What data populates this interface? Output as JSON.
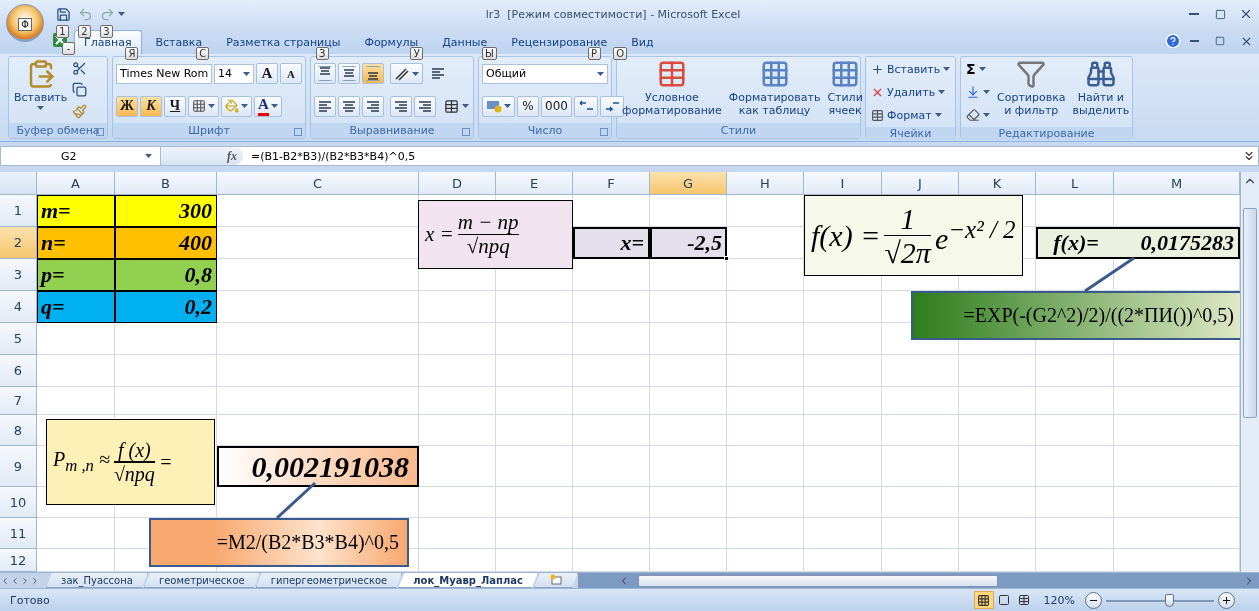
{
  "window": {
    "title": "lr3  [Режим совместимости] - Microsoft Excel",
    "office_keytip": "Ф",
    "quick_access_keytips": [
      "1",
      "2",
      "3"
    ],
    "app_icon_keytip": "-"
  },
  "tabs": [
    {
      "label": "Главная",
      "selected": true,
      "keytip": "Я"
    },
    {
      "label": "Вставка",
      "selected": false,
      "keytip": "С"
    },
    {
      "label": "Разметка страницы",
      "selected": false,
      "keytip": "З"
    },
    {
      "label": "Формулы",
      "selected": false,
      "keytip": "У"
    },
    {
      "label": "Данные",
      "selected": false,
      "keytip": "Ы"
    },
    {
      "label": "Рецензирование",
      "selected": false,
      "keytip": "Р"
    },
    {
      "label": "Вид",
      "selected": false,
      "keytip": "О"
    }
  ],
  "ribbon": {
    "clipboard": {
      "label": "Буфер обмена",
      "paste": "Вставить"
    },
    "font": {
      "label": "Шрифт",
      "font_name": "Times New Rom",
      "font_size": "14",
      "grow": "A",
      "shrink": "A",
      "styles": [
        {
          "label": "Ж",
          "on": true
        },
        {
          "label": "К",
          "on": true
        },
        {
          "label": "Ч",
          "on": false
        }
      ],
      "font_color": "A"
    },
    "alignment": {
      "label": "Выравнивание",
      "vertical": [
        {
          "kind": "top",
          "selected": false
        },
        {
          "kind": "middle",
          "selected": false
        },
        {
          "kind": "bottom",
          "selected": true
        }
      ]
    },
    "number": {
      "label": "Число",
      "format": "Общий",
      "percent": "%",
      "thousands": "000"
    },
    "styles": {
      "label": "Стили",
      "buttons": [
        "Условное\nформатирование",
        "Форматировать\nкак таблицу",
        "Стили\nячеек"
      ]
    },
    "cells": {
      "label": "Ячейки",
      "buttons": [
        "Вставить",
        "Удалить",
        "Формат"
      ]
    },
    "editing": {
      "label": "Редактирование",
      "sum": "Σ",
      "buttons": [
        "Сортировка\nи фильтр",
        "Найти и\nвыделить"
      ]
    }
  },
  "formula_bar": {
    "name_box": "G2",
    "function_label": "fx",
    "formula": "=(B1-B2*B3)/(B2*B3*B4)^0,5"
  },
  "columns": [
    {
      "label": "A",
      "selected": false
    },
    {
      "label": "B",
      "selected": false
    },
    {
      "label": "C",
      "selected": false
    },
    {
      "label": "D",
      "selected": false
    },
    {
      "label": "E",
      "selected": false
    },
    {
      "label": "F",
      "selected": false
    },
    {
      "label": "G",
      "selected": true
    },
    {
      "label": "H",
      "selected": false
    },
    {
      "label": "I",
      "selected": false
    },
    {
      "label": "J",
      "selected": false
    },
    {
      "label": "K",
      "selected": false
    },
    {
      "label": "L",
      "selected": false
    },
    {
      "label": "M",
      "selected": false
    }
  ],
  "rows": [
    {
      "label": "1",
      "selected": false,
      "cells": {
        "A": {
          "text": "m=",
          "kind": "label",
          "color": "#ffff00",
          "selected": false
        },
        "B": {
          "text": "300",
          "kind": "value",
          "color": "#ffff00",
          "selected": false
        }
      }
    },
    {
      "label": "2",
      "selected": true,
      "cells": {
        "A": {
          "text": "n=",
          "kind": "label",
          "color": "#ffc000",
          "selected": false
        },
        "B": {
          "text": "400",
          "kind": "value",
          "color": "#ffc000",
          "selected": false
        },
        "F": {
          "text": "x=",
          "kind": "boxed",
          "color": "#e4dfec",
          "selected": false
        },
        "G": {
          "text": "-2,5",
          "kind": "value",
          "color": "#e4dfec",
          "selected": true
        },
        "L": {
          "text": "f(x)=",
          "kind": "boxed_start",
          "color": "#ebf1de",
          "selected": false
        },
        "M": {
          "text": "0,0175283",
          "kind": "boxed_end",
          "color": "#ebf1de",
          "selected": false
        }
      }
    },
    {
      "label": "3",
      "selected": false,
      "cells": {
        "A": {
          "text": "p=",
          "kind": "label",
          "color": "#92d050",
          "selected": false
        },
        "B": {
          "text": "0,8",
          "kind": "value",
          "color": "#92d050",
          "selected": false
        }
      }
    },
    {
      "label": "4",
      "selected": false,
      "cells": {
        "A": {
          "text": "q=",
          "kind": "label",
          "color": "#00b0f0",
          "selected": false
        },
        "B": {
          "text": "0,2",
          "kind": "value",
          "color": "#00b0f0",
          "selected": false
        }
      }
    },
    {
      "label": "5",
      "selected": false
    },
    {
      "label": "6",
      "selected": false
    },
    {
      "label": "7",
      "selected": false
    },
    {
      "label": "8",
      "selected": false
    },
    {
      "label": "9",
      "selected": false,
      "cells": {
        "C": {
          "text": "0,002191038",
          "kind": "big",
          "color": "#f9b98c",
          "selected": false
        }
      }
    },
    {
      "label": "10",
      "selected": false
    },
    {
      "label": "11",
      "selected": false
    },
    {
      "label": "12",
      "selected": false
    }
  ],
  "shapes": [
    {
      "kind": "formula",
      "color": "#f2e3f1",
      "lhs": "x =",
      "numerator": "m − np",
      "denominator": "√npq"
    },
    {
      "kind": "formula",
      "color": "#f6f9ea",
      "lhs": "f(x) =",
      "numerator": "1",
      "denominator": "√2π",
      "rhs": "e$^{−x² / 2}$"
    },
    {
      "kind": "callout",
      "color": "#2e7d1c",
      "text": "=EXP(-(G2^2)/2)/((2*ПИ())^0,5)"
    },
    {
      "kind": "formula",
      "color": "#fdf1b7",
      "lhs": "P$_{m ,n}$ ≈",
      "numerator": "f (x)",
      "denominator": "√npq",
      "rhs": "="
    },
    {
      "kind": "callout",
      "color": "#f9a870",
      "text": "=M2/(B2*B3*B4)^0,5"
    }
  ],
  "sheet_tabs": [
    {
      "label": "зак_Пуассона",
      "selected": false
    },
    {
      "label": "геометрическое",
      "selected": false
    },
    {
      "label": "гипергеометрическое",
      "selected": false
    },
    {
      "label": "лок_Муавр_Лаплас",
      "selected": true
    }
  ],
  "status_bar": {
    "text": "Готово",
    "views": [
      {
        "kind": "normal",
        "selected": true
      },
      {
        "kind": "page_layout",
        "selected": false
      },
      {
        "kind": "page_break",
        "selected": false
      }
    ],
    "zoom": "120%",
    "zoom_slider": {
      "level": 0.58
    }
  }
}
